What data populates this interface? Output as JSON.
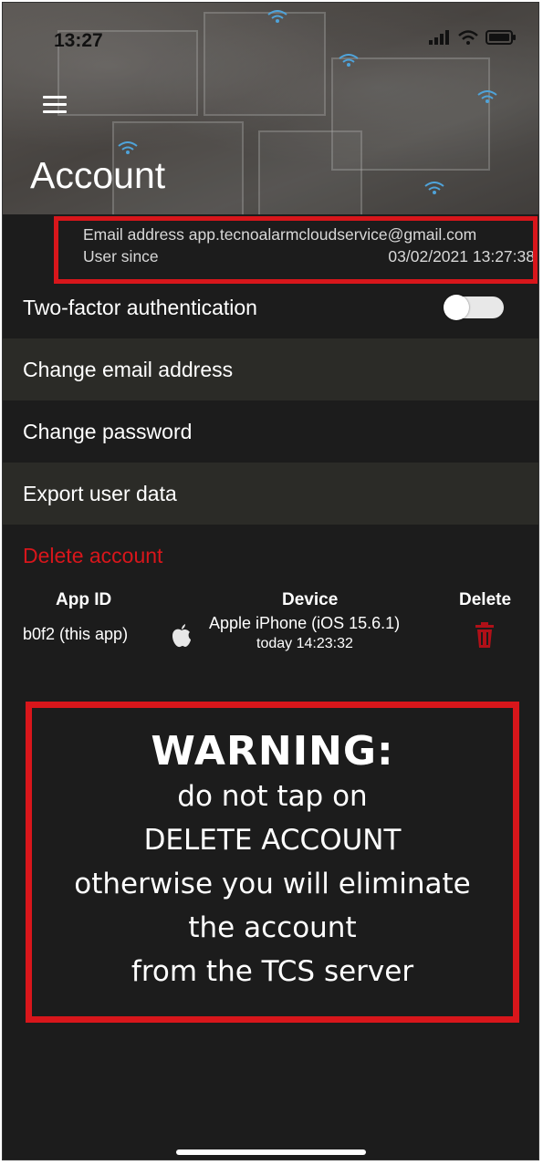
{
  "status_bar": {
    "time": "13:27"
  },
  "header": {
    "title": "Account"
  },
  "info": {
    "email_label": "Email address",
    "email_value": "app.tecnoalarmcloudservice@gmail.com",
    "user_since_label": "User since",
    "user_since_value": "03/02/2021 13:27:38"
  },
  "settings": {
    "two_factor": {
      "label": "Two-factor authentication",
      "enabled": false
    },
    "change_email": "Change email address",
    "change_password": "Change password",
    "export_data": "Export user data",
    "delete_account": "Delete account"
  },
  "devices": {
    "headers": {
      "app_id": "App ID",
      "device": "Device",
      "delete": "Delete"
    },
    "rows": [
      {
        "app_id": "b0f2 (this app)",
        "device": "Apple iPhone (iOS 15.6.1)",
        "last_seen": "today 14:23:32",
        "icon": "apple-icon"
      }
    ]
  },
  "warning": {
    "title": "WARNING:",
    "lines": [
      "do not tap on",
      "DELETE ACCOUNT",
      "otherwise you will eliminate",
      "the account",
      "from the TCS server"
    ]
  },
  "colors": {
    "accent_red": "#d8161b",
    "background": "#1c1c1c",
    "alt_row": "#2b2b27"
  }
}
